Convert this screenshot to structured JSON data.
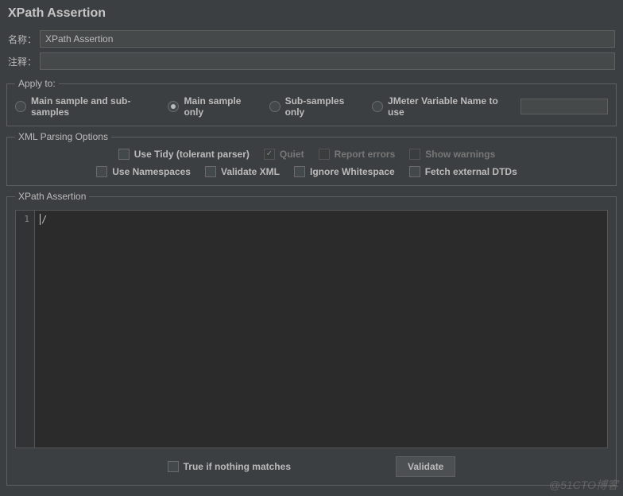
{
  "title": "XPath Assertion",
  "nameField": {
    "label": "名称：",
    "value": "XPath Assertion"
  },
  "commentField": {
    "label": "注释：",
    "value": ""
  },
  "applyTo": {
    "legend": "Apply to:",
    "options": [
      {
        "label": "Main sample and sub-samples",
        "selected": false
      },
      {
        "label": "Main sample only",
        "selected": true
      },
      {
        "label": "Sub-samples only",
        "selected": false
      },
      {
        "label": "JMeter Variable Name to use",
        "selected": false
      }
    ],
    "variableValue": ""
  },
  "xmlParsing": {
    "legend": "XML Parsing Options",
    "row1": [
      {
        "label": "Use Tidy (tolerant parser)",
        "checked": false,
        "disabled": false
      },
      {
        "label": "Quiet",
        "checked": true,
        "disabled": true
      },
      {
        "label": "Report errors",
        "checked": false,
        "disabled": true
      },
      {
        "label": "Show warnings",
        "checked": false,
        "disabled": true
      }
    ],
    "row2": [
      {
        "label": "Use Namespaces",
        "checked": false,
        "disabled": false
      },
      {
        "label": "Validate XML",
        "checked": false,
        "disabled": false
      },
      {
        "label": "Ignore Whitespace",
        "checked": false,
        "disabled": false
      },
      {
        "label": "Fetch external DTDs",
        "checked": false,
        "disabled": false
      }
    ]
  },
  "xpathAssertion": {
    "legend": "XPath Assertion",
    "lineNumber": "1",
    "code": "/",
    "trueIfNothing": {
      "label": "True if nothing matches",
      "checked": false
    },
    "validateButton": "Validate"
  },
  "watermark": "@51CTO博客"
}
